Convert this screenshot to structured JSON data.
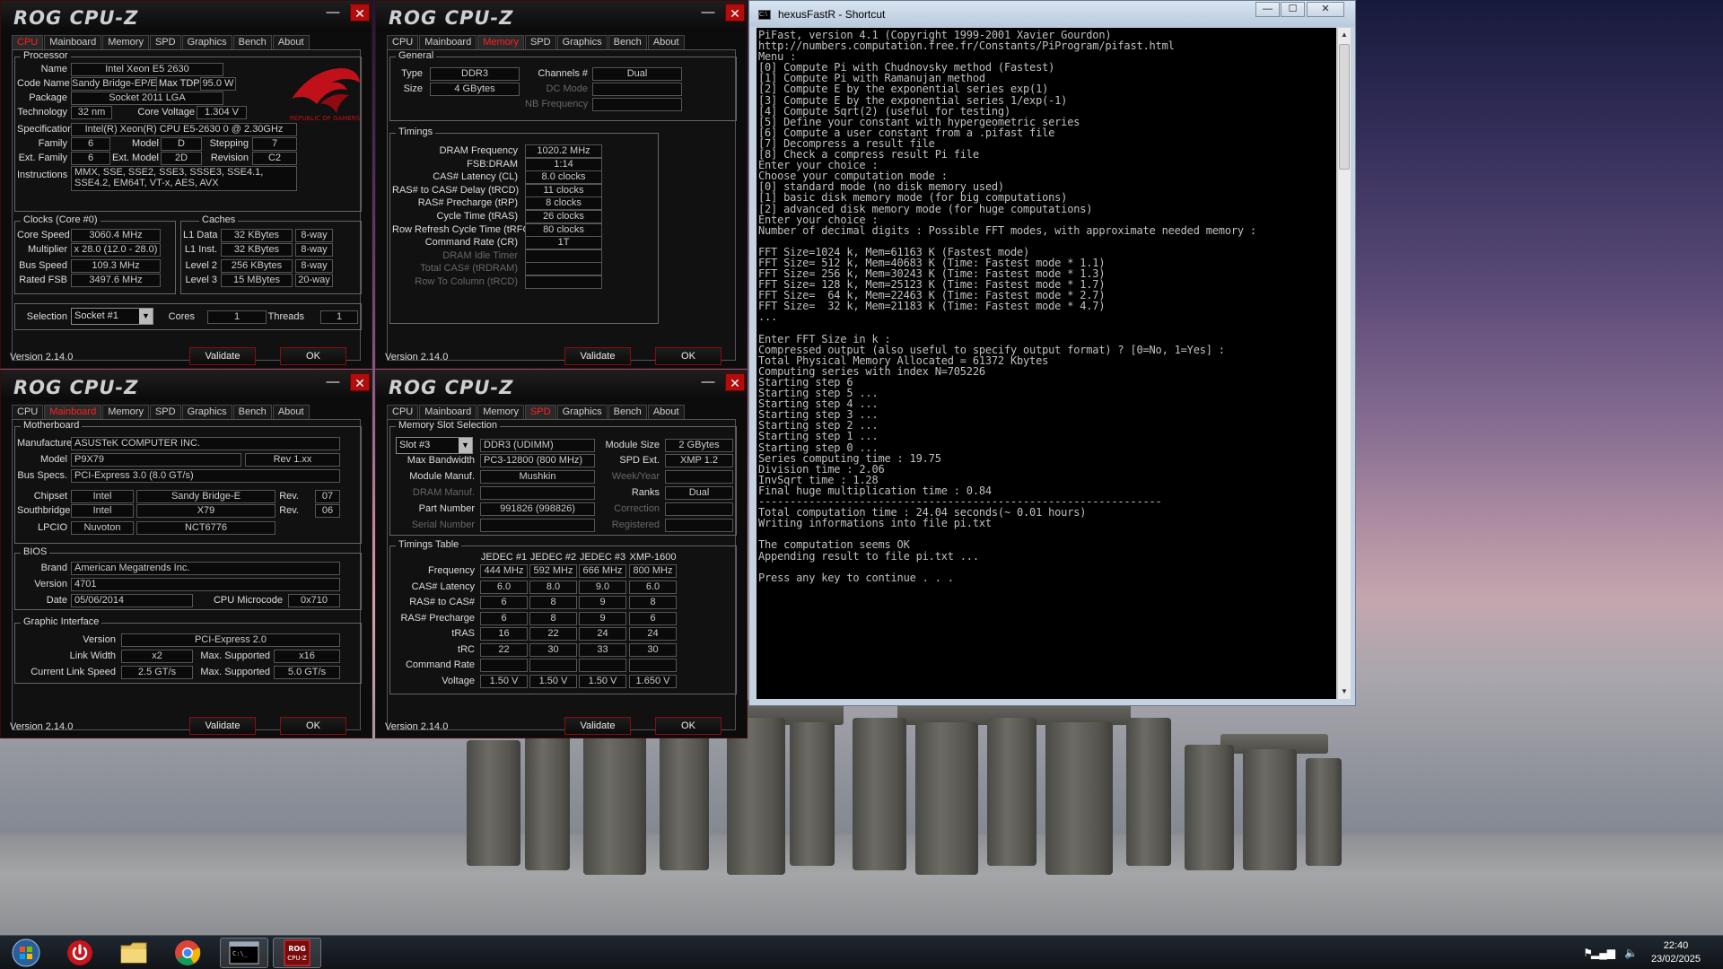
{
  "taskbar": {
    "time": "22:40",
    "date": "23/02/2025"
  },
  "cmd": {
    "title": "hexusFastR - Shortcut",
    "min": "—",
    "max": "☐",
    "close": "✕",
    "lines": [
      "PiFast, version 4.1 (Copyright 1999-2001 Xavier Gourdon)",
      "http://numbers.computation.free.fr/Constants/PiProgram/pifast.html",
      "Menu :",
      "[0] Compute Pi with Chudnovsky method (Fastest)",
      "[1] Compute Pi with Ramanujan method",
      "[2] Compute E by the exponential series exp(1)",
      "[3] Compute E by the exponential series 1/exp(-1)",
      "[4] Compute Sqrt(2) (useful for testing)",
      "[5] Define your constant with hypergeometric series",
      "[6] Compute a user constant from a .pifast file",
      "[7] Decompress a result file",
      "[8] Check a compress result Pi file",
      "Enter your choice :",
      "Choose your computation mode :",
      "[0] standard mode (no disk memory used)",
      "[1] basic disk memory mode (for big computations)",
      "[2] advanced disk memory mode (for huge computations)",
      "Enter your choice :",
      "Number of decimal digits : Possible FFT modes, with approximate needed memory :",
      "",
      "FFT Size=1024 k, Mem=61163 K (Fastest mode)",
      "FFT Size= 512 k, Mem=40683 K (Time: Fastest mode * 1.1)",
      "FFT Size= 256 k, Mem=30243 K (Time: Fastest mode * 1.3)",
      "FFT Size= 128 k, Mem=25123 K (Time: Fastest mode * 1.7)",
      "FFT Size=  64 k, Mem=22463 K (Time: Fastest mode * 2.7)",
      "FFT Size=  32 k, Mem=21183 K (Time: Fastest mode * 4.7)",
      "...",
      "",
      "Enter FFT Size in k :",
      "Compressed output (also useful to specify output format) ? [0=No, 1=Yes] :",
      "Total Physical Memory Allocated = 61372 Kbytes",
      "Computing series with index N=705226",
      "Starting step 6",
      "Starting step 5 ...",
      "Starting step 4 ...",
      "Starting step 3 ...",
      "Starting step 2 ...",
      "Starting step 1 ...",
      "Starting step 0 ...",
      "Series computing time : 19.75",
      "Division time : 2.06",
      "InvSqrt time : 1.28",
      "Final huge multiplication time : 0.84",
      "----------------------------------------------------------------",
      "Total computation time : 24.04 seconds(~ 0.01 hours)",
      "Writing informations into file pi.txt",
      "",
      "The computation seems OK",
      "Appending result to file pi.txt ...",
      "",
      "Press any key to continue . . ."
    ]
  },
  "common": {
    "logo": "ROG CPU-Z",
    "version": "Version 2.14.0",
    "validate": "Validate",
    "ok": "OK",
    "min": "—",
    "close": "✕",
    "tabs": [
      "CPU",
      "Mainboard",
      "Memory",
      "SPD",
      "Graphics",
      "Bench",
      "About"
    ]
  },
  "cpu": {
    "processor": "Processor",
    "name_l": "Name",
    "name": "Intel Xeon E5 2630",
    "codename_l": "Code Name",
    "codename": "Sandy Bridge-EP/EX",
    "maxtdp_l": "Max TDP",
    "maxtdp": "95.0 W",
    "package_l": "Package",
    "package": "Socket 2011 LGA",
    "tech_l": "Technology",
    "tech": "32 nm",
    "corev_l": "Core Voltage",
    "corev": "1.304 V",
    "spec_l": "Specification",
    "spec": "Intel(R) Xeon(R) CPU E5-2630 0 @ 2.30GHz",
    "family_l": "Family",
    "family": "6",
    "model_l": "Model",
    "model": "D",
    "stepping_l": "Stepping",
    "stepping": "7",
    "extfam_l": "Ext. Family",
    "extfam": "6",
    "extmodel_l": "Ext. Model",
    "extmodel": "2D",
    "rev_l": "Revision",
    "rev": "C2",
    "instr_l": "Instructions",
    "instr": "MMX, SSE, SSE2, SSE3, SSSE3, SSE4.1, SSE4.2, EM64T, VT-x, AES, AVX",
    "clocks": "Clocks (Core #0)",
    "caches": "Caches",
    "corespeed_l": "Core Speed",
    "corespeed": "3060.4 MHz",
    "mult_l": "Multiplier",
    "mult": "x 28.0 (12.0 - 28.0)",
    "bus_l": "Bus Speed",
    "bus": "109.3 MHz",
    "fsb_l": "Rated FSB",
    "fsb": "3497.6 MHz",
    "l1d_l": "L1 Data",
    "l1d": "32 KBytes",
    "l1d_w": "8-way",
    "l1i_l": "L1 Inst.",
    "l1i": "32 KBytes",
    "l1i_w": "8-way",
    "l2_l": "Level 2",
    "l2": "256 KBytes",
    "l2_w": "8-way",
    "l3_l": "Level 3",
    "l3": "15 MBytes",
    "l3_w": "20-way",
    "selection_l": "Selection",
    "selection": "Socket #1",
    "cores_l": "Cores",
    "cores": "1",
    "threads_l": "Threads",
    "threads": "1",
    "rog_text": "REPUBLIC OF GAMERS"
  },
  "memory": {
    "general": "General",
    "type_l": "Type",
    "type": "DDR3",
    "size_l": "Size",
    "size": "4 GBytes",
    "channels_l": "Channels #",
    "channels": "Dual",
    "dc_l": "DC Mode",
    "nb_l": "NB Frequency",
    "timings": "Timings",
    "rows": [
      {
        "l": "DRAM Frequency",
        "v": "1020.2 MHz"
      },
      {
        "l": "FSB:DRAM",
        "v": "1:14"
      },
      {
        "l": "CAS# Latency (CL)",
        "v": "8.0 clocks"
      },
      {
        "l": "RAS# to CAS# Delay (tRCD)",
        "v": "11 clocks"
      },
      {
        "l": "RAS# Precharge (tRP)",
        "v": "8 clocks"
      },
      {
        "l": "Cycle Time (tRAS)",
        "v": "26 clocks"
      },
      {
        "l": "Row Refresh Cycle Time (tRFC)",
        "v": "80 clocks"
      },
      {
        "l": "Command Rate (CR)",
        "v": "1T"
      },
      {
        "l": "DRAM Idle Timer",
        "v": ""
      },
      {
        "l": "Total CAS# (tRDRAM)",
        "v": ""
      },
      {
        "l": "Row To Column (tRCD)",
        "v": ""
      }
    ]
  },
  "mainboard": {
    "motherboard": "Motherboard",
    "manuf_l": "Manufacturer",
    "manuf": "ASUSTeK COMPUTER INC.",
    "model_l": "Model",
    "model": "P9X79",
    "modelrev": "Rev 1.xx",
    "busspecs_l": "Bus Specs.",
    "busspecs": "PCI-Express 3.0 (8.0 GT/s)",
    "chipset_l": "Chipset",
    "chipset_v": "Intel",
    "chipset_m": "Sandy Bridge-E",
    "chipset_rl": "Rev.",
    "chipset_r": "07",
    "south_l": "Southbridge",
    "south_v": "Intel",
    "south_m": "X79",
    "south_rl": "Rev.",
    "south_r": "06",
    "lpcio_l": "LPCIO",
    "lpcio_v": "Nuvoton",
    "lpcio_m": "NCT6776",
    "bios": "BIOS",
    "brand_l": "Brand",
    "brand": "American Megatrends Inc.",
    "bver_l": "Version",
    "bver": "4701",
    "bdate_l": "Date",
    "bdate": "05/06/2014",
    "micro_l": "CPU Microcode",
    "micro": "0x710",
    "gi": "Graphic Interface",
    "giver_l": "Version",
    "giver": "PCI-Express 2.0",
    "lw_l": "Link Width",
    "lw": "x2",
    "maxs_l": "Max. Supported",
    "maxs": "x16",
    "cls_l": "Current Link Speed",
    "cls": "2.5 GT/s",
    "maxs2_l": "Max. Supported",
    "maxs2": "5.0 GT/s"
  },
  "spd": {
    "slotsel": "Memory Slot Selection",
    "slot": "Slot #3",
    "slottype": "DDR3 (UDIMM)",
    "modsize_l": "Module Size",
    "modsize": "2 GBytes",
    "maxbw_l": "Max Bandwidth",
    "maxbw": "PC3-12800 (800 MHz)",
    "spdext_l": "SPD Ext.",
    "spdext": "XMP 1.2",
    "modman_l": "Module Manuf.",
    "modman": "Mushkin",
    "weekyear_l": "Week/Year",
    "drammanuf_l": "DRAM Manuf.",
    "ranks_l": "Ranks",
    "ranks": "Dual",
    "part_l": "Part Number",
    "part": "991826 (998826)",
    "corr_l": "Correction",
    "serial_l": "Serial Number",
    "reg_l": "Registered",
    "tt": "Timings Table",
    "cols": [
      "JEDEC #1",
      "JEDEC #2",
      "JEDEC #3",
      "XMP-1600"
    ],
    "rows": [
      {
        "l": "Frequency",
        "v": [
          "444 MHz",
          "592 MHz",
          "666 MHz",
          "800 MHz"
        ]
      },
      {
        "l": "CAS# Latency",
        "v": [
          "6.0",
          "8.0",
          "9.0",
          "6.0"
        ]
      },
      {
        "l": "RAS# to CAS#",
        "v": [
          "6",
          "8",
          "9",
          "8"
        ]
      },
      {
        "l": "RAS# Precharge",
        "v": [
          "6",
          "8",
          "9",
          "6"
        ]
      },
      {
        "l": "tRAS",
        "v": [
          "16",
          "22",
          "24",
          "24"
        ]
      },
      {
        "l": "tRC",
        "v": [
          "22",
          "30",
          "33",
          "30"
        ]
      },
      {
        "l": "Command Rate",
        "v": [
          "",
          "",
          "",
          ""
        ]
      },
      {
        "l": "Voltage",
        "v": [
          "1.50 V",
          "1.50 V",
          "1.50 V",
          "1.650 V"
        ]
      }
    ]
  }
}
